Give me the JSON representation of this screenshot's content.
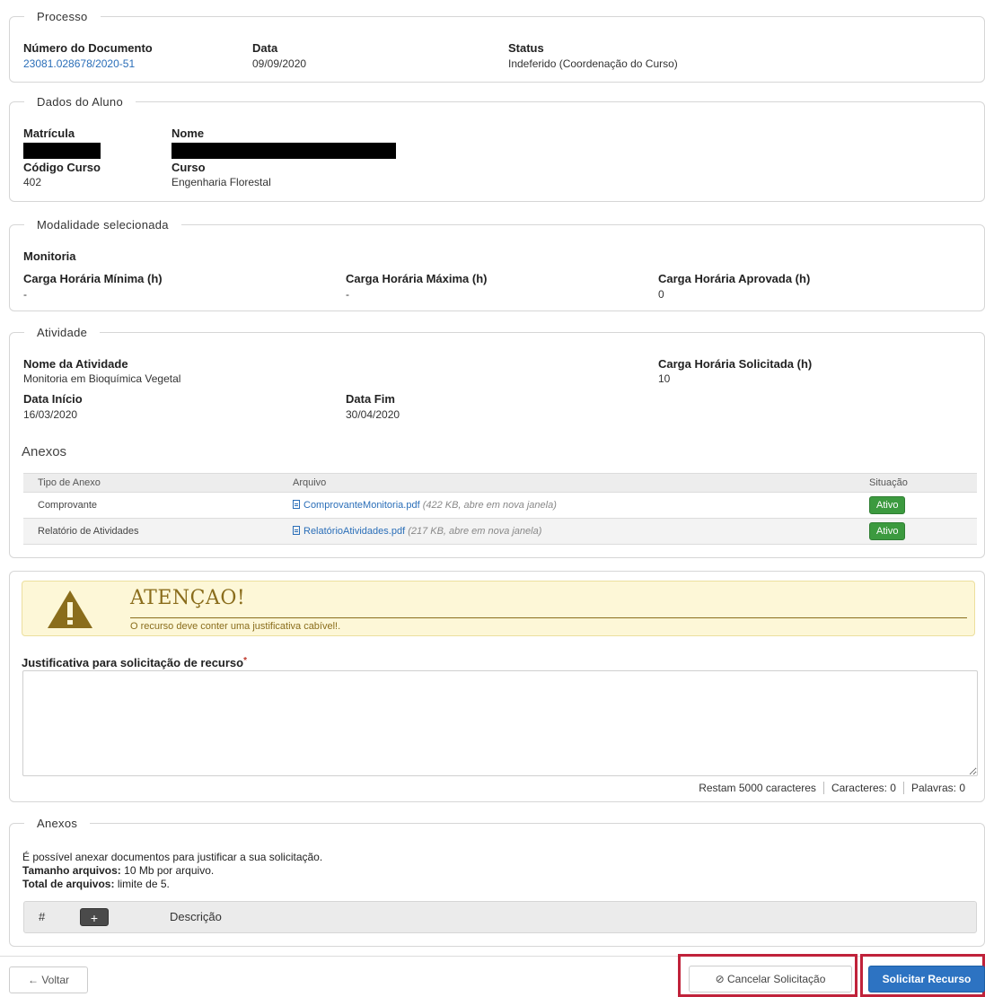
{
  "processo": {
    "legend": "Processo",
    "numero_label": "Número do Documento",
    "numero_value": "23081.028678/2020-51",
    "data_label": "Data",
    "data_value": "09/09/2020",
    "status_label": "Status",
    "status_value": "Indeferido (Coordenação do Curso)"
  },
  "aluno": {
    "legend": "Dados do Aluno",
    "matricula_label": "Matrícula",
    "nome_label": "Nome",
    "codigo_label": "Código Curso",
    "codigo_value": "402",
    "curso_label": "Curso",
    "curso_value": "Engenharia Florestal"
  },
  "modalidade": {
    "legend": "Modalidade selecionada",
    "name": "Monitoria",
    "min_label": "Carga Horária Mínima (h)",
    "min_value": "-",
    "max_label": "Carga Horária Máxima (h)",
    "max_value": "-",
    "aprov_label": "Carga Horária Aprovada (h)",
    "aprov_value": "0"
  },
  "atividade": {
    "legend": "Atividade",
    "nome_label": "Nome da Atividade",
    "nome_value": "Monitoria em Bioquímica Vegetal",
    "carga_label": "Carga Horária Solicitada (h)",
    "carga_value": "10",
    "inicio_label": "Data Início",
    "inicio_value": "16/03/2020",
    "fim_label": "Data Fim",
    "fim_value": "30/04/2020",
    "anexos_title": "Anexos",
    "table_headers": [
      "Tipo de Anexo",
      "Arquivo",
      "Situação"
    ],
    "rows": [
      {
        "tipo": "Comprovante",
        "arquivo": "ComprovanteMonitoria.pdf",
        "meta": "(422 KB, abre em nova janela)",
        "situacao": "Ativo"
      },
      {
        "tipo": "Relatório de Atividades",
        "arquivo": "RelatórioAtividades.pdf",
        "meta": "(217 KB, abre em nova janela)",
        "situacao": "Ativo"
      }
    ]
  },
  "aviso": {
    "title": "ATENÇAO!",
    "text": "O recurso deve conter uma justificativa cabível!.",
    "icon": "warning-triangle-icon"
  },
  "justificativa": {
    "label": "Justificativa para solicitação de recurso",
    "required_mark": "*",
    "value": "",
    "restam": "Restam 5000 caracteres",
    "caracteres": "Caracteres: 0",
    "palavras": "Palavras: 0"
  },
  "upload": {
    "legend": "Anexos",
    "info": "É possível anexar documentos para justificar a sua solicitação.",
    "tamanho_label": "Tamanho arquivos:",
    "tamanho_value": "10 Mb por arquivo.",
    "total_label": "Total de arquivos:",
    "total_value": "limite de 5.",
    "col_num": "#",
    "add_label": "+",
    "col_desc": "Descrição"
  },
  "footer": {
    "voltar": "← Voltar",
    "cancelar": "⊘ Cancelar Solicitação",
    "recurso": "Solicitar Recurso"
  },
  "colors": {
    "link": "#2a6eb8",
    "badge_green": "#3c9a3f",
    "warning_text": "#8a6d1c",
    "warning_bg": "#fdf7d7",
    "primary_button": "#2d73c2",
    "highlight_red": "#c0223a"
  }
}
